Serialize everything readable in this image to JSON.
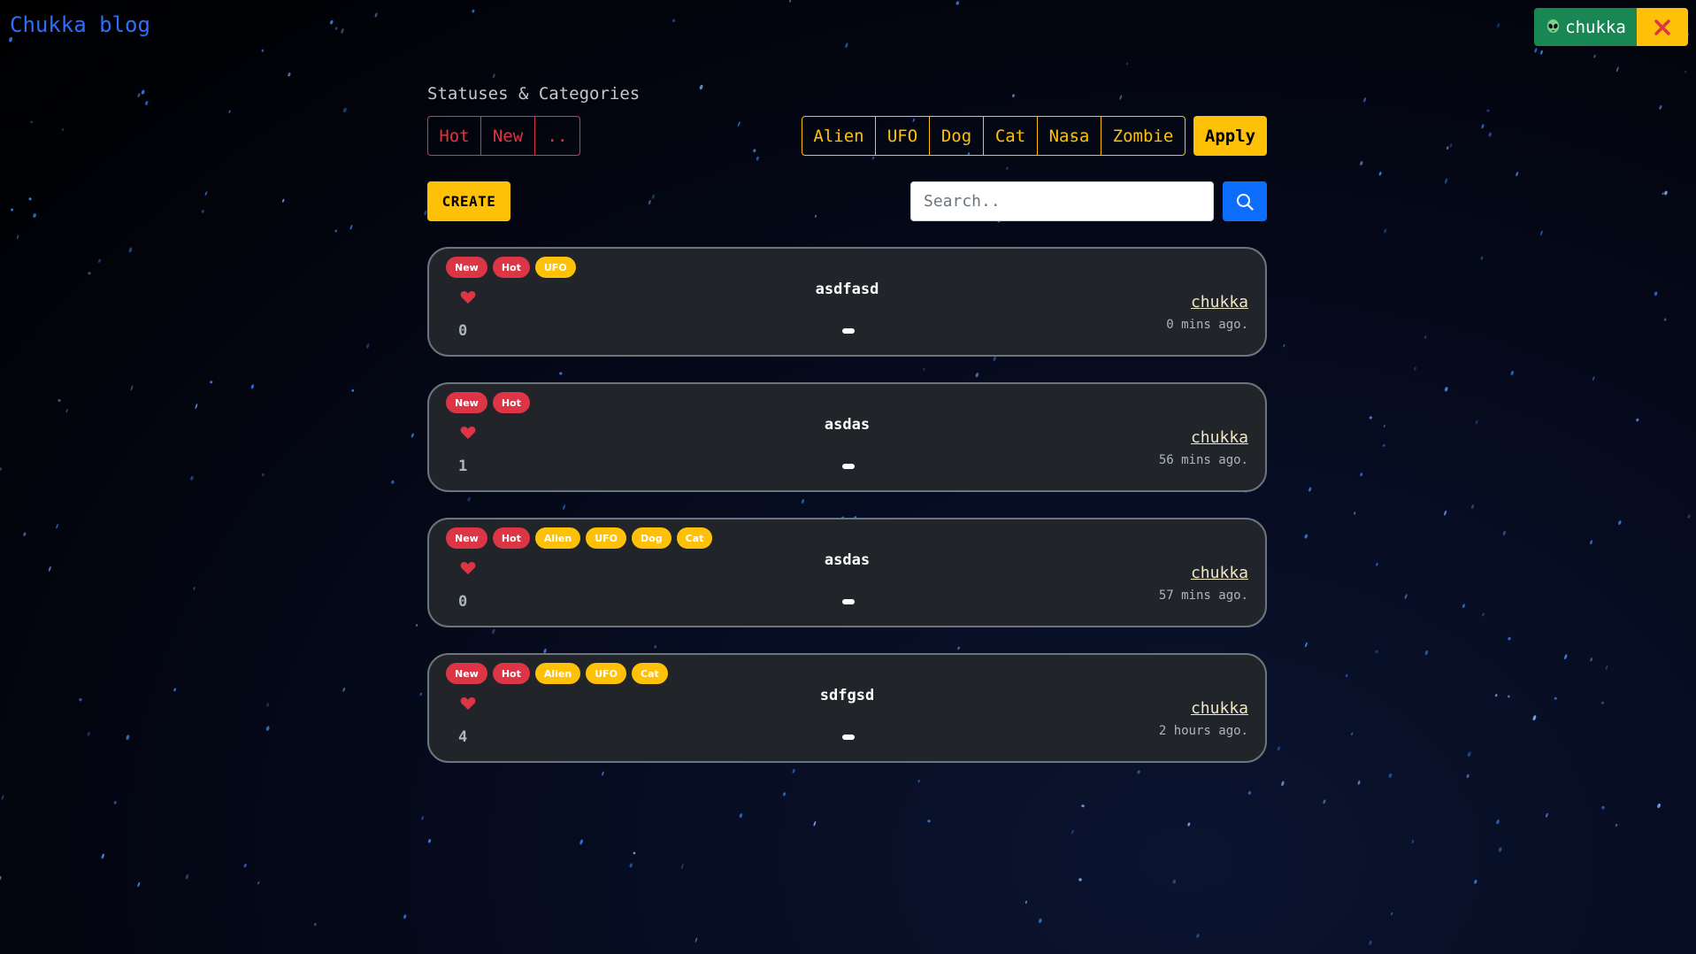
{
  "app": {
    "brand": "Chukka blog"
  },
  "user": {
    "name": "chukka",
    "avatar_icon": "alien-icon",
    "logout_icon": "close-icon"
  },
  "filters": {
    "label": "Statuses & Categories",
    "statuses": [
      "Hot",
      "New",
      ".."
    ],
    "categories": [
      "Alien",
      "UFO",
      "Dog",
      "Cat",
      "Nasa",
      "Zombie"
    ],
    "apply_label": "Apply"
  },
  "toolbar": {
    "create_label": "CREATE",
    "search_placeholder": "Search..",
    "search_icon": "search-icon"
  },
  "colors": {
    "danger": "#dc3545",
    "warning": "#ffc107",
    "success": "#198754",
    "primary": "#0d6efd",
    "card": "#212529"
  },
  "posts": [
    {
      "badges": [
        {
          "text": "New",
          "color": "red"
        },
        {
          "text": "Hot",
          "color": "red"
        },
        {
          "text": "UFO",
          "color": "yellow"
        }
      ],
      "likes": "0",
      "title": "asdfasd",
      "author": "chukka",
      "time": "0 mins ago."
    },
    {
      "badges": [
        {
          "text": "New",
          "color": "red"
        },
        {
          "text": "Hot",
          "color": "red"
        }
      ],
      "likes": "1",
      "title": "asdas",
      "author": "chukka",
      "time": "56 mins ago."
    },
    {
      "badges": [
        {
          "text": "New",
          "color": "red"
        },
        {
          "text": "Hot",
          "color": "red"
        },
        {
          "text": "Alien",
          "color": "yellow"
        },
        {
          "text": "UFO",
          "color": "yellow"
        },
        {
          "text": "Dog",
          "color": "yellow"
        },
        {
          "text": "Cat",
          "color": "yellow"
        }
      ],
      "likes": "0",
      "title": "asdas",
      "author": "chukka",
      "time": "57 mins ago."
    },
    {
      "badges": [
        {
          "text": "New",
          "color": "red"
        },
        {
          "text": "Hot",
          "color": "red"
        },
        {
          "text": "Alien",
          "color": "yellow"
        },
        {
          "text": "UFO",
          "color": "yellow"
        },
        {
          "text": "Cat",
          "color": "yellow"
        }
      ],
      "likes": "4",
      "title": "sdfgsd",
      "author": "chukka",
      "time": "2 hours ago."
    }
  ]
}
